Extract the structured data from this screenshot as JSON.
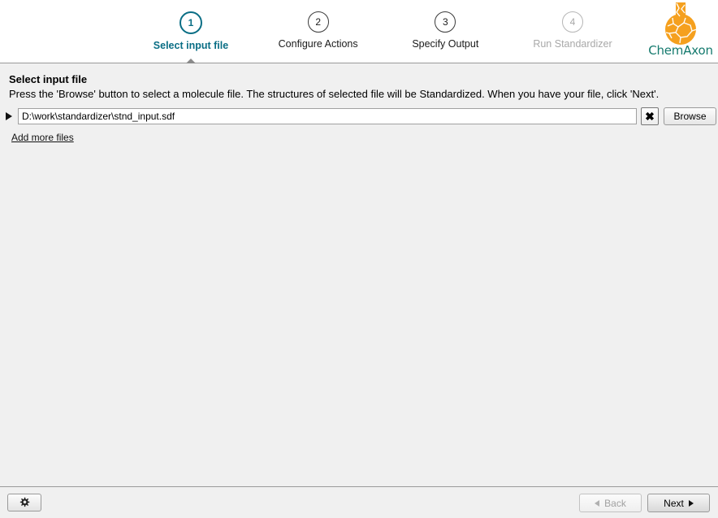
{
  "header": {
    "steps": [
      {
        "number": "1",
        "label": "Select input file",
        "state": "active"
      },
      {
        "number": "2",
        "label": "Configure Actions",
        "state": "enabled"
      },
      {
        "number": "3",
        "label": "Specify Output",
        "state": "enabled"
      },
      {
        "number": "4",
        "label": "Run Standardizer",
        "state": "disabled"
      }
    ],
    "logo": {
      "text": "ChemAxon",
      "flask_color": "#F5A01E",
      "text_color": "#157A6E"
    }
  },
  "main": {
    "title": "Select input file",
    "description": "Press the 'Browse' button to select a molecule file. The structures of selected file will be Standardized. When you have your file, click 'Next'.",
    "file_row": {
      "expander_icon": "triangle-right-icon",
      "path_value": "D:\\work\\standardizer\\stnd_input.sdf",
      "path_placeholder": "",
      "clear_label": "✖",
      "browse_label": "Browse"
    },
    "add_more_files_label": "Add more files"
  },
  "footer": {
    "settings_icon": "gear-icon",
    "back_label": "Back",
    "next_label": "Next"
  },
  "theme": {
    "accent": "#0A6E85",
    "body_bg": "#F0F0F0",
    "header_bg": "#FFFFFF",
    "disabled_text": "#A8A8A8"
  }
}
